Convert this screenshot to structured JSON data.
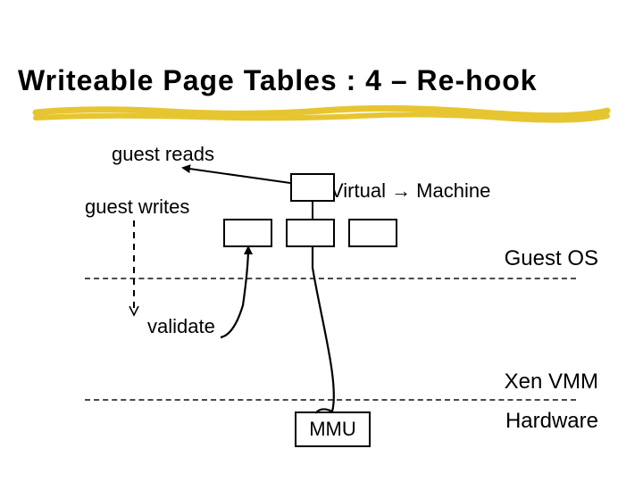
{
  "title": "Writeable Page Tables : 4 – Re-hook",
  "labels": {
    "guest_reads": "guest reads",
    "guest_writes": "guest writes",
    "virtual_machine": "Virtual → Machine",
    "validate": "validate"
  },
  "layers": {
    "guest_os": "Guest OS",
    "xen_vmm": "Xen VMM",
    "hardware": "Hardware"
  },
  "mmu_box": "MMU"
}
